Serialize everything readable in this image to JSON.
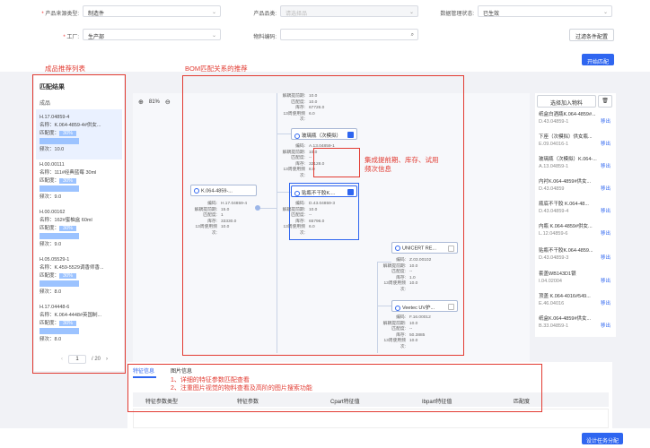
{
  "filters": {
    "product_source_type": {
      "label": "产品来源类型:",
      "value": "制造件"
    },
    "product_category": {
      "label": "产品品类:",
      "placeholder": "请选择品"
    },
    "data_status": {
      "label": "数据管理状态:",
      "value": "已生效"
    },
    "factory": {
      "label": "工厂:",
      "value": "生产部"
    },
    "material_code": {
      "label": "物料编码:",
      "value": ""
    },
    "filter_config_button": "过滤条件配置",
    "start_match_button": "开始匹配"
  },
  "annotations": {
    "product_list": "成品推荐列表",
    "bom_relation": "BOM匹配关系的推荐",
    "lead_time": "集成提前期、库存、试用频次信息",
    "detail_1": "1、详细的特征参数匹配查看",
    "detail_2": "2、注重图片视觉的物料查看及高阶的图片搜索功能"
  },
  "left": {
    "title": "匹配结果",
    "column": "成品",
    "name_label": "名称：",
    "degree_label": "匹配度：",
    "freq_label": "频次：",
    "items": [
      {
        "code": "H.17.04859-4",
        "name": "K.064-4859-4#供女...",
        "degree": "30%",
        "freq": "10.0"
      },
      {
        "code": "H.00.00111",
        "name": "111#经典蓝莓 30ml",
        "degree": "30%",
        "freq": "9.0"
      },
      {
        "code": "H.00.00162",
        "name": "162#蜜柚盒 60ml",
        "degree": "30%",
        "freq": "9.0"
      },
      {
        "code": "H.05.05529-1",
        "name": "K.459-5529调香师香...",
        "degree": "30%",
        "freq": "8.0"
      },
      {
        "code": "H.17.04448-6",
        "name": "K.064-4448#英国制...",
        "degree": "30%",
        "freq": "8.0"
      }
    ],
    "pagination": {
      "current": "1",
      "total": "/ 20",
      "prev": "‹",
      "next": "›"
    }
  },
  "graph": {
    "zoom": "81%",
    "zoom_in": "⊕",
    "zoom_out": "⊖",
    "info_keys": [
      "编码:",
      "解耦提前期:",
      "匹配度:",
      "库存:",
      "13周使用频次:"
    ],
    "root": {
      "label": "K.064-4859-...",
      "info": [
        "H.17.04859-4",
        "15.0",
        "1",
        "33330.0",
        "10.0"
      ]
    },
    "top_partial": {
      "info": [
        "10.0",
        "10.0",
        "67726.0",
        "6.0"
      ]
    },
    "node_glass": {
      "label": "玻璃瓶（次模拟）",
      "info": [
        "A.13.04859-1",
        "10.0",
        "--",
        "32128.0",
        "8.0"
      ]
    },
    "node_label": {
      "label": "贴瓶不干胶K....",
      "info": [
        "D.43.04859-3",
        "10.0",
        "--",
        "65796.0",
        "6.0"
      ]
    },
    "node_unicert": {
      "label": "UNICERT RE...",
      "info": [
        "Z.03.00102",
        "10.0",
        "--",
        "1.0",
        "10.0"
      ]
    },
    "node_veetec": {
      "label": "Veetec UV护...",
      "info": [
        "F.16.00012",
        "10.0",
        "--",
        "50.3885",
        "10.0"
      ]
    }
  },
  "right": {
    "add_button": "选择加入物料",
    "delete_icon": "trash-icon",
    "remove": "移出",
    "items": [
      {
        "name": "纸盒白酒瓶K.064-4859#...",
        "code": "D.43.04859-1"
      },
      {
        "name": "下座（次模拟）供女瓶...",
        "code": "E.09.04016-1"
      },
      {
        "name": "玻璃瓶（次模拟）K.064-...",
        "code": "A.13.04859-1"
      },
      {
        "name": "内衬K.064-4859#供女...",
        "code": "D.43.04859"
      },
      {
        "name": "瓶底不干胶 K.064-48...",
        "code": "D.43.04859-4"
      },
      {
        "name": "内瓶 K.064-4859#供女...",
        "code": "L.12.04859-6"
      },
      {
        "name": "贴瓶不干胶K.064-4859...",
        "code": "D.43.04859-3"
      },
      {
        "name": "套盖WB143D1银",
        "code": "I.04.02004"
      },
      {
        "name": "顶盖 K.064-4016#549...",
        "code": "E.46.04016"
      },
      {
        "name": "纸盒K.064-4859#供女...",
        "code": "B.33.04859-1"
      }
    ]
  },
  "bottom": {
    "tabs": [
      "特征信息",
      "图片信息"
    ],
    "columns": [
      "特征参数类型",
      "特征参数",
      "Cpart特征值",
      "Ibpart特征值",
      "匹配度"
    ],
    "submit_button": "设计任务分配"
  },
  "colors": {
    "accent": "#2f66f0",
    "annotation": "#e23b32"
  }
}
